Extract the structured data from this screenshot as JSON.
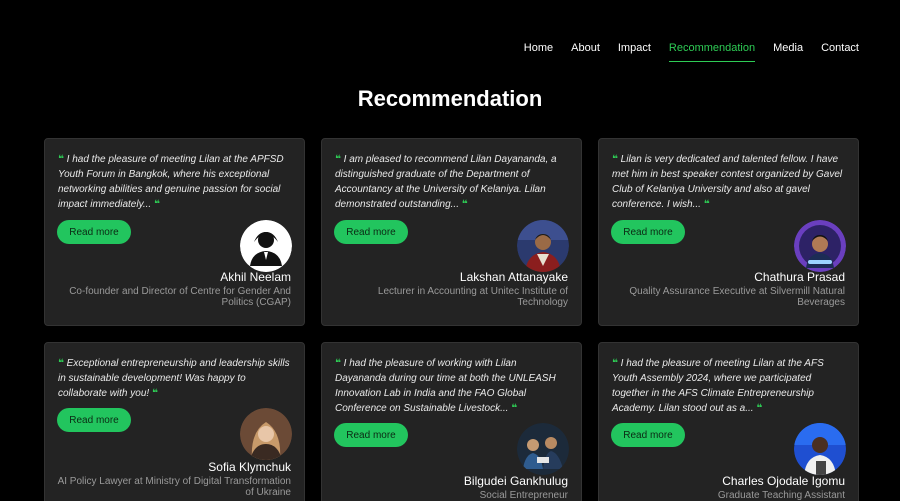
{
  "nav": {
    "items": [
      {
        "label": "Home"
      },
      {
        "label": "About"
      },
      {
        "label": "Impact"
      },
      {
        "label": "Recommendation"
      },
      {
        "label": "Media"
      },
      {
        "label": "Contact"
      }
    ],
    "active": "Recommendation"
  },
  "page": {
    "title": "Recommendation"
  },
  "quote_mark": "❝",
  "quote_end": "❞",
  "colors": {
    "accent": "#2ecc55",
    "card": "#232323",
    "background": "#000000"
  },
  "cards": [
    {
      "quote": "I had the pleasure of meeting Lilan at the APFSD Youth Forum in Bangkok, where his exceptional networking abilities and genuine passion for social impact immediately...",
      "button": "Read more",
      "name": "Akhil Neelam",
      "role": "Co-founder and Director of Centre for Gender And Politics (CGAP)"
    },
    {
      "quote": "I am pleased to recommend Lilan Dayananda, a distinguished graduate of the Department of Accountancy at the University of Kelaniya. Lilan demonstrated outstanding...",
      "button": "Read more",
      "name": "Lakshan Attanayake",
      "role": "Lecturer in Accounting at Unitec Institute of Technology"
    },
    {
      "quote": "Lilan is very dedicated and talented fellow. I have met him in best speaker contest organized by Gavel Club of Kelaniya University and also at gavel conference. I wish...",
      "button": "Read more",
      "name": "Chathura Prasad",
      "role": "Quality Assurance Executive at Silvermill Natural Beverages"
    },
    {
      "quote": "Exceptional entrepreneurship and leadership skills in sustainable development! Was happy to collaborate with you!",
      "button": "Read more",
      "name": "Sofia Klymchuk",
      "role": "AI Policy Lawyer at Ministry of Digital Transformation of Ukraine"
    },
    {
      "quote": "I had the pleasure of working with Lilan Dayananda during our time at both the UNLEASH Innovation Lab in India and the FAO Global Conference on Sustainable Livestock...",
      "button": "Read more",
      "name": "Bilgudei Gankhulug",
      "role": "Social Entrepreneur"
    },
    {
      "quote": "I had the pleasure of meeting Lilan at the AFS Youth Assembly 2024, where we participated together in the AFS Climate Entrepreneurship Academy. Lilan stood out as a...",
      "button": "Read more",
      "name": "Charles Ojodale Igomu",
      "role": "Graduate Teaching Assistant"
    }
  ]
}
